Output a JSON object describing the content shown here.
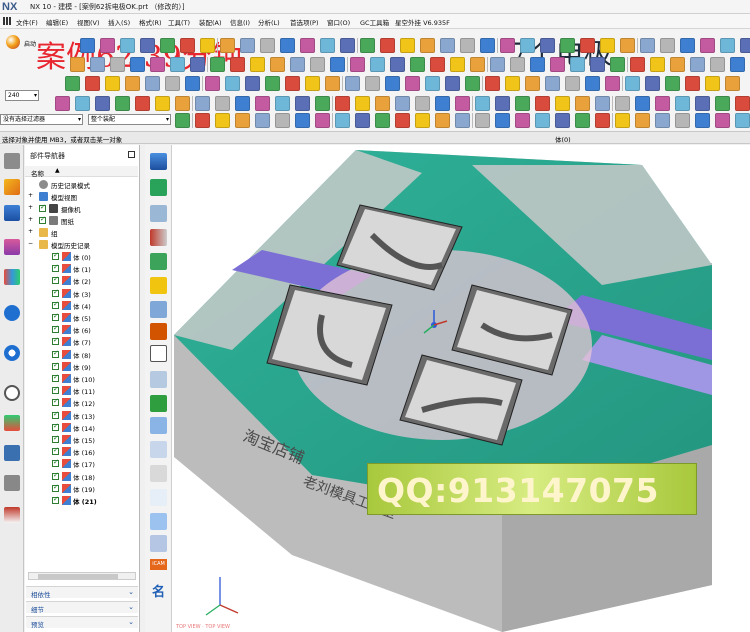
{
  "window": {
    "logo": "NX",
    "title": "NX 10 - 建模 - [案例62拆电极OK.prt （修改的）]"
  },
  "menu": [
    {
      "label": "文件(F)",
      "icon": "menu-grid-icon"
    },
    {
      "label": "编辑(E)"
    },
    {
      "label": "视图(V)"
    },
    {
      "label": "插入(S)"
    },
    {
      "label": "格式(R)"
    },
    {
      "label": "工具(T)"
    },
    {
      "label": "装配(A)"
    },
    {
      "label": "信息(I)"
    },
    {
      "label": "分析(L)"
    },
    {
      "label": "首选项(P)"
    },
    {
      "label": "窗口(O)"
    },
    {
      "label": "GC工具箱"
    },
    {
      "label": "星空外挂 V6.935F"
    }
  ],
  "toolbar": {
    "start_label": "启动",
    "zoom_value": "240"
  },
  "overlays": {
    "left": "案例62   39分钟",
    "right": "7个电极"
  },
  "filters": {
    "type_filter": "没有选择过滤器",
    "assembly_filter": "整个装配"
  },
  "status": {
    "prompt": "选择对象并使用 MB3，或者双击某一对象",
    "selection": "体(0)"
  },
  "navigator": {
    "title": "部件导航器",
    "column": "名称",
    "tree": [
      {
        "label": "历史记录模式",
        "icon": "clock-icon"
      },
      {
        "label": "模型视图",
        "icon": "views-icon"
      },
      {
        "label": "摄像机",
        "icon": "camera-icon"
      },
      {
        "label": "图纸",
        "icon": "drawing-icon"
      },
      {
        "label": "组",
        "icon": "folder-icon"
      },
      {
        "label": "模型历史记录",
        "icon": "folder-icon"
      }
    ],
    "bodies": [
      "体 (0)",
      "体 (1)",
      "体 (2)",
      "体 (3)",
      "体 (4)",
      "体 (5)",
      "体 (6)",
      "体 (7)",
      "体 (8)",
      "体 (9)",
      "体 (10)",
      "体 (11)",
      "体 (12)",
      "体 (13)",
      "体 (14)",
      "体 (15)",
      "体 (16)",
      "体 (17)",
      "体 (18)",
      "体 (19)",
      "体 (21)"
    ],
    "panels": [
      "相依性",
      "细节",
      "预览"
    ]
  },
  "viewport": {
    "engraving_top": "淘宝店铺",
    "engraving_bottom": "老刘模具工作室",
    "qq_banner": "QQ:913147075",
    "footer": "TOP VIEW · TOP VIEW"
  },
  "vtool": {
    "icam_label": "iCAM",
    "ming_label": "名"
  },
  "colors": {
    "accent_red": "#e8262f",
    "mold_gray": "#c4c4c4",
    "channel_purple": "#7b6fd6",
    "mint": "#2fb39a",
    "banner_green": "#b7d55b"
  }
}
